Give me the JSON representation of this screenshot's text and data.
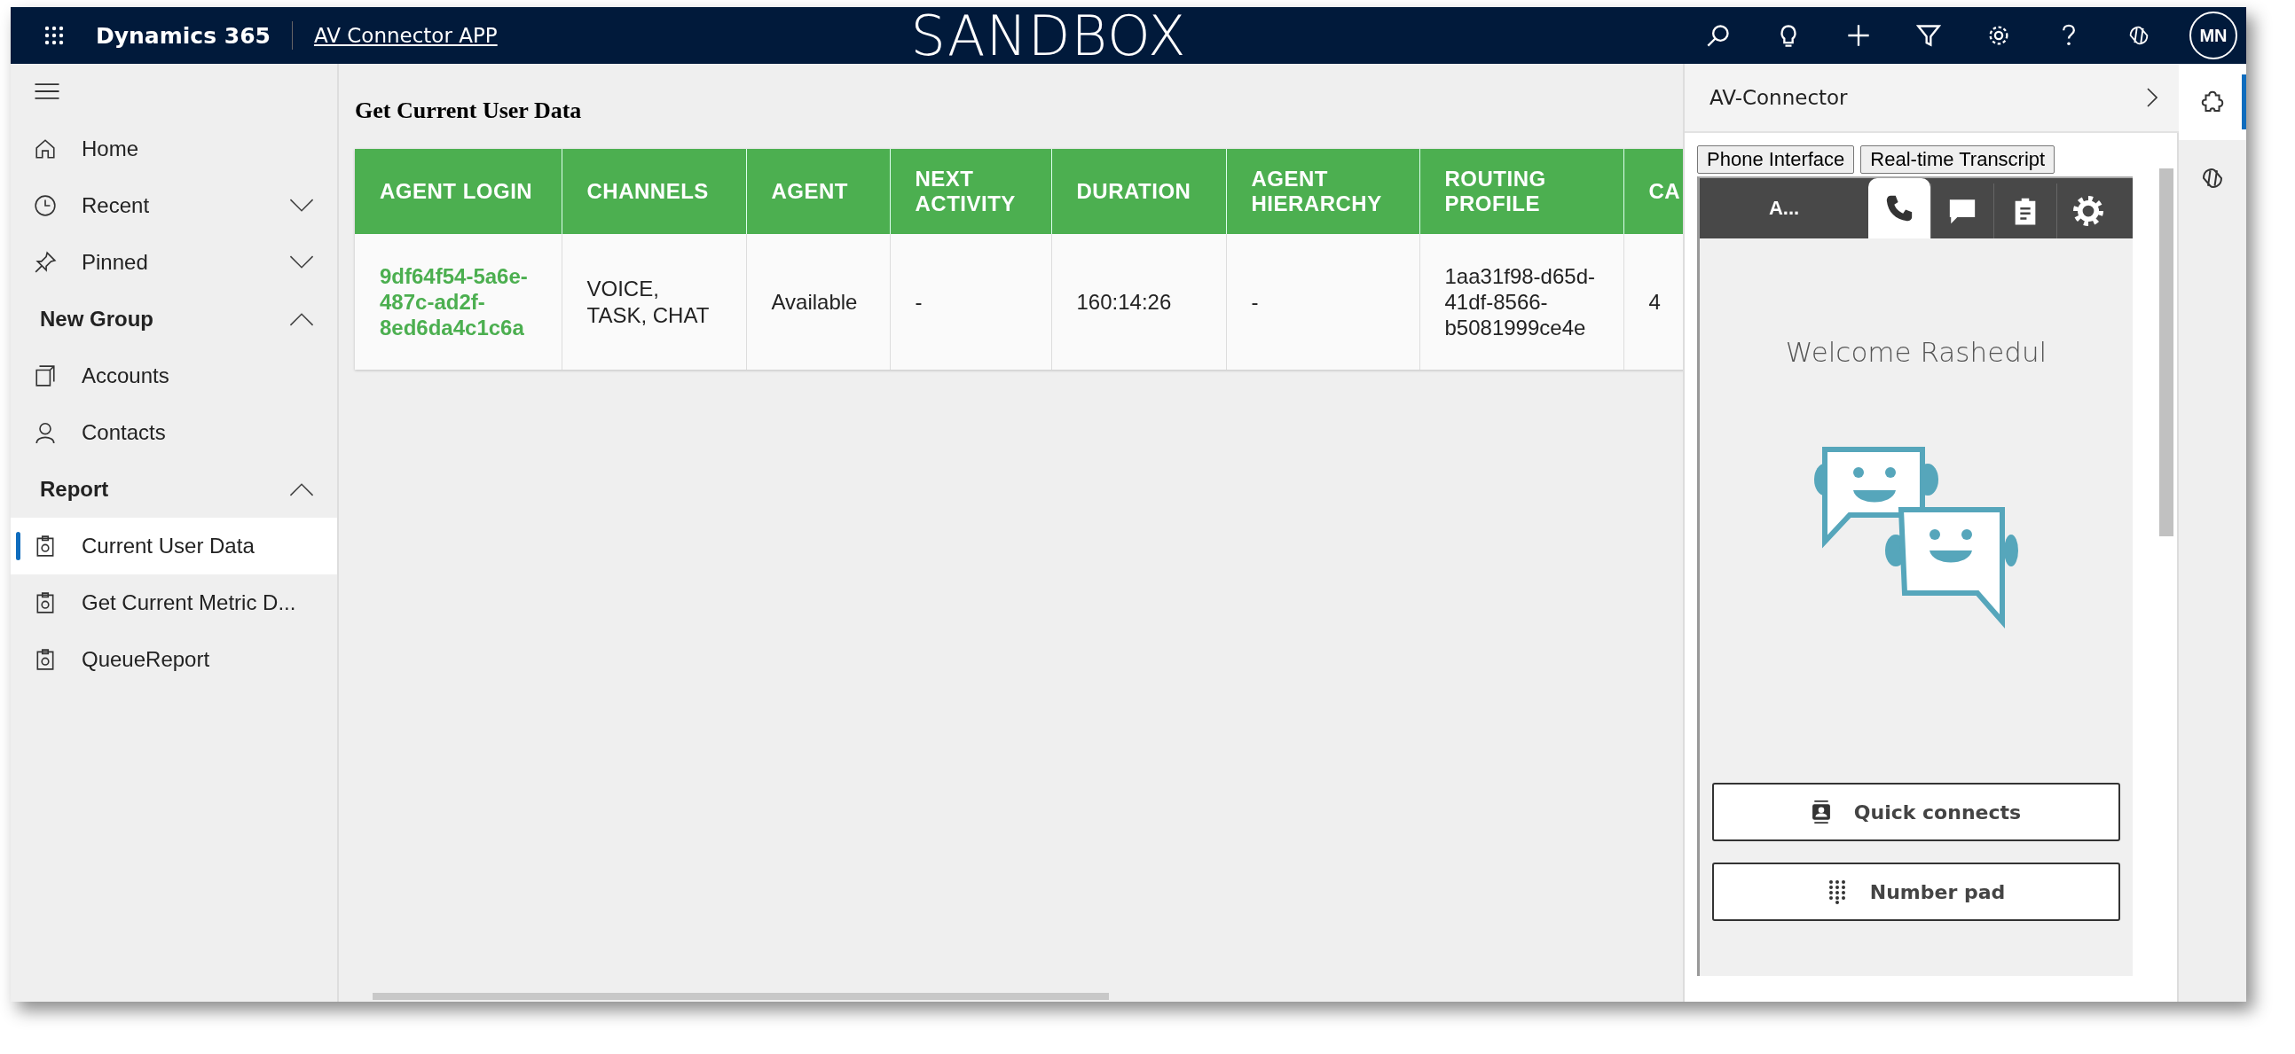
{
  "top_bar": {
    "app_name": "Dynamics 365",
    "app_link": "AV Connector APP",
    "banner": "SANDBOX",
    "avatar": "MN"
  },
  "sidebar": {
    "nav": [
      {
        "label": "Home",
        "kind": "home"
      },
      {
        "label": "Recent",
        "kind": "recent",
        "expanded": false
      },
      {
        "label": "Pinned",
        "kind": "pinned",
        "expanded": false
      }
    ],
    "groups": [
      {
        "title": "New Group",
        "expanded": true,
        "items": [
          {
            "label": "Accounts",
            "kind": "accounts",
            "selected": false
          },
          {
            "label": "Contacts",
            "kind": "contacts",
            "selected": false
          }
        ]
      },
      {
        "title": "Report",
        "expanded": true,
        "items": [
          {
            "label": "Current User Data",
            "kind": "report",
            "selected": true
          },
          {
            "label": "Get Current Metric D...",
            "kind": "report",
            "selected": false
          },
          {
            "label": "QueueReport",
            "kind": "report",
            "selected": false
          }
        ]
      }
    ]
  },
  "main": {
    "title": "Get Current User Data",
    "table": {
      "columns": [
        "AGENT LOGIN",
        "CHANNELS",
        "AGENT",
        "NEXT ACTIVITY",
        "DURATION",
        "AGENT HIERARCHY",
        "ROUTING PROFILE",
        "CA"
      ],
      "rows": [
        [
          "9df64f54-5a6e-487c-ad2f-8ed6da4c1c6a",
          "VOICE, TASK, CHAT",
          "Available",
          "-",
          "160:14:26",
          "-",
          "1aa31f98-d65d-41df-8566-b5081999ce4e",
          "4"
        ]
      ]
    }
  },
  "panel": {
    "title": "AV-Connector",
    "tab_buttons": [
      "Phone Interface",
      "Real-time Transcript"
    ],
    "ccp": {
      "status": "A...",
      "tabs": [
        {
          "kind": "phone",
          "selected": true
        },
        {
          "kind": "chat",
          "selected": false
        },
        {
          "kind": "task",
          "selected": false
        },
        {
          "kind": "settings",
          "selected": false
        }
      ],
      "welcome": "Welcome Rashedul",
      "buttons": [
        {
          "label": "Quick connects",
          "kind": "quick-connects"
        },
        {
          "label": "Number pad",
          "kind": "number-pad"
        }
      ]
    }
  },
  "rail": [
    {
      "kind": "puzzle",
      "selected": true
    },
    {
      "kind": "copilot",
      "selected": false
    }
  ]
}
